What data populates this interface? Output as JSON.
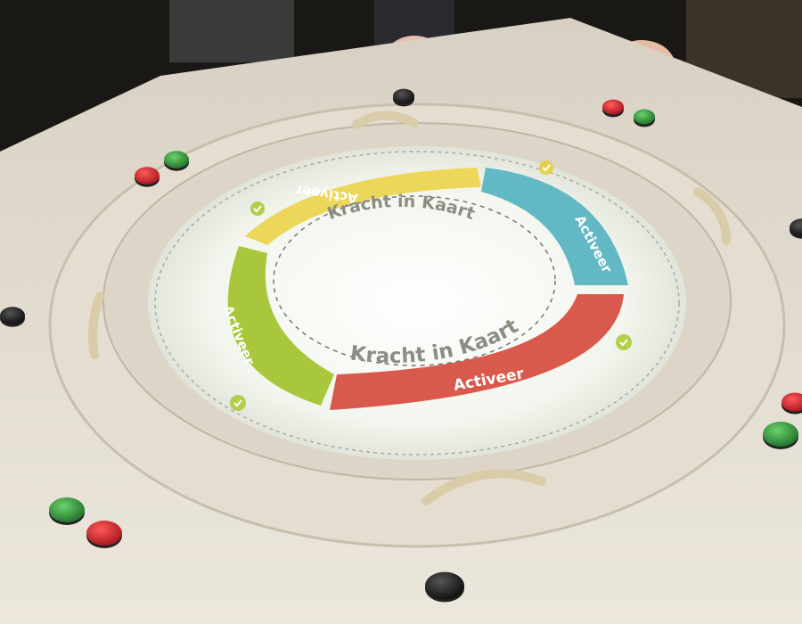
{
  "colors": {
    "table": "#e7e1d6",
    "wall": "#1a1814",
    "screen_glow": "#f6f8f0",
    "segment_yellow": "#e9d24a",
    "segment_teal": "#57b6c6",
    "segment_red": "#db5a4c",
    "segment_green": "#a7c93a",
    "button_red": "#c8202a",
    "button_green": "#2f8f3a",
    "button_black": "#1c1c1c",
    "center_text": "#8d8d84"
  },
  "screen": {
    "center_title": "Kracht in Kaart",
    "inner_title": "Kracht in Kaart"
  },
  "segments": [
    {
      "id": "yellow",
      "label": "Activeer",
      "color": "#e9d24a"
    },
    {
      "id": "teal",
      "label": "Activeer",
      "color": "#57b6c6"
    },
    {
      "id": "red",
      "label": "Activeer",
      "color": "#db5a4c"
    },
    {
      "id": "green",
      "label": "Activeer",
      "color": "#a7c93a"
    }
  ],
  "icons": [
    "check-icon-top-left",
    "check-icon-top-right",
    "check-icon-right",
    "check-icon-bottom-left"
  ],
  "physical_buttons": [
    "red",
    "green",
    "black",
    "red",
    "green",
    "black",
    "black",
    "red",
    "green",
    "green",
    "red",
    "black",
    "black"
  ]
}
